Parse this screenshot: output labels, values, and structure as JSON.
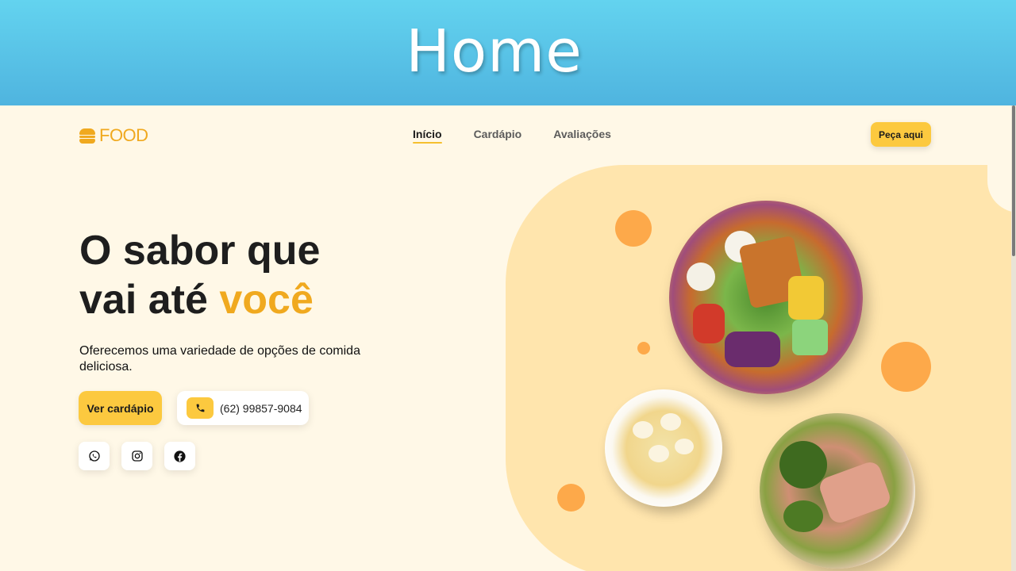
{
  "banner": {
    "title": "Home"
  },
  "header": {
    "logo_text": "FOOD",
    "nav": [
      {
        "label": "Início",
        "active": true
      },
      {
        "label": "Cardápio",
        "active": false
      },
      {
        "label": "Avaliações",
        "active": false
      }
    ],
    "order_button": "Peça aqui"
  },
  "hero": {
    "headline_line1": "O sabor que",
    "headline_line2_prefix": "vai até ",
    "headline_accent": "você",
    "subtitle": "Oferecemos uma variedade de opções de comida deliciosa.",
    "menu_button": "Ver cardápio",
    "phone_number": "(62) 99857-9084",
    "socials": [
      "whatsapp-icon",
      "instagram-icon",
      "facebook-icon"
    ]
  },
  "colors": {
    "accent": "#f0a91f",
    "button_yellow": "#fcc93f",
    "hero_bg": "#ffe5ad",
    "page_bg": "#fff8e7",
    "dot_orange": "#fda94a",
    "banner_blue": "#5bc6ea"
  }
}
